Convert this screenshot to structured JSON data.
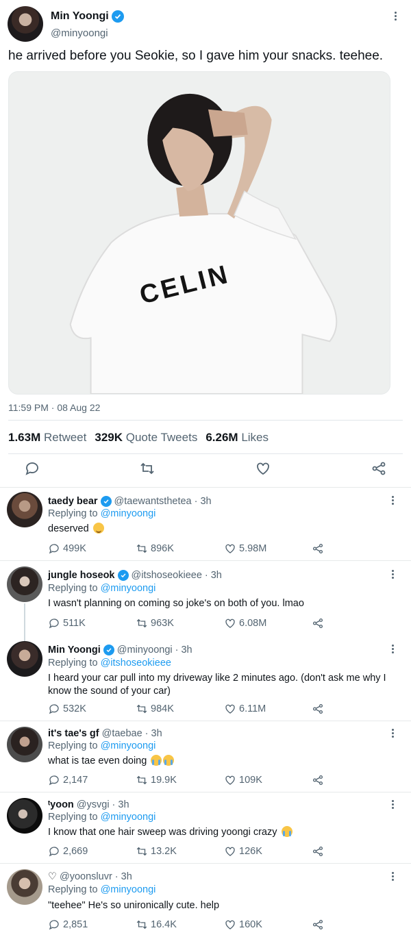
{
  "tweet": {
    "author_name": "Min Yoongi",
    "author_handle": "@minyoongi",
    "text": "he arrived before you Seokie, so I gave him your snacks. teehee.",
    "image_shirt_text": "CELIN",
    "timestamp": "11:59 PM · 08 Aug 22",
    "stats": {
      "retweets": "1.63M",
      "retweets_label": "Retweet",
      "quotes": "329K",
      "quotes_label": "Quote Tweets",
      "likes": "6.26M",
      "likes_label": "Likes"
    }
  },
  "replies": [
    {
      "name": "taedy bear",
      "verified": true,
      "handle": "@taewantsthetea",
      "time": "· 3h",
      "replying_label": "Replying to",
      "replying_to": "@minyoongi",
      "text": "deserved",
      "emoji": "relieved-face",
      "replies": "499K",
      "retweets": "896K",
      "likes": "5.98M"
    },
    {
      "name": "jungle hoseok",
      "verified": true,
      "handle": "@itshoseokieee",
      "time": "· 3h",
      "replying_label": "Replying to",
      "replying_to": "@minyoongi",
      "text": "I wasn't planning on coming so joke's on both of you. lmao",
      "replies": "511K",
      "retweets": "963K",
      "likes": "6.08M"
    },
    {
      "name": "Min Yoongi",
      "verified": true,
      "handle": "@minyoongi",
      "time": "· 3h",
      "replying_label": "Replying to",
      "replying_to": "@itshoseokieee",
      "text": "I heard your car pull into my driveway like 2 minutes ago. (don't ask me why I know the sound of your car)",
      "replies": "532K",
      "retweets": "984K",
      "likes": "6.11M"
    },
    {
      "name": "it's tae's gf",
      "verified": false,
      "handle": "@taebae",
      "time": "· 3h",
      "replying_label": "Replying to",
      "replying_to": "@minyoongi",
      "text": "what is tae even doing",
      "emoji": "crying-faces",
      "replies": "2,147",
      "retweets": "19.9K",
      "likes": "109K"
    },
    {
      "name": "ᵗyoon",
      "verified": false,
      "handle": "@ysvgi",
      "time": "· 3h",
      "replying_label": "Replying to",
      "replying_to": "@minyoongi",
      "text": "I know that one hair sweep was driving yoongi crazy",
      "emoji": "crying-face",
      "replies": "2,669",
      "retweets": "13.2K",
      "likes": "126K"
    },
    {
      "name": "♡",
      "verified": false,
      "handle": "@yoonsluvr",
      "time": "· 3h",
      "replying_label": "Replying to",
      "replying_to": "@minyoongi",
      "text": "\"teehee\" He's so unironically cute. help",
      "replies": "2,851",
      "retweets": "16.4K",
      "likes": "160K"
    }
  ],
  "colors": {
    "accent": "#1d9bf0",
    "secondary_text": "#536471",
    "primary_text": "#0f1419",
    "divider": "#e6e9ea"
  },
  "icons": [
    "verified-badge-icon",
    "more-icon",
    "reply-icon",
    "retweet-icon",
    "like-icon",
    "share-icon"
  ]
}
